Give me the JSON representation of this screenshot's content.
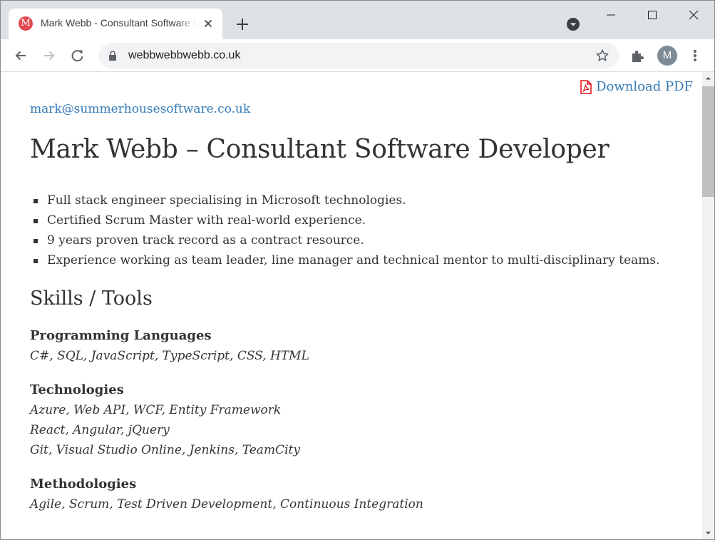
{
  "browser": {
    "tab_title": "Mark Webb - Consultant Software Developer",
    "favicon_letter": "M",
    "url": "webbwebbwebb.co.uk",
    "profile_initial": "M"
  },
  "page": {
    "download_label": "Download PDF",
    "email": "mark@summerhousesoftware.co.uk",
    "heading": "Mark Webb – Consultant Software Developer",
    "points": [
      "Full stack engineer specialising in Microsoft technologies.",
      "Certified Scrum Master with real-world experience.",
      "9 years proven track record as a contract resource.",
      "Experience working as team leader, line manager and technical mentor to multi-disciplinary teams."
    ],
    "skills_heading": "Skills / Tools",
    "skills": [
      {
        "label": "Programming Languages",
        "lines": [
          "C#, SQL, JavaScript, TypeScript, CSS, HTML"
        ]
      },
      {
        "label": "Technologies",
        "lines": [
          "Azure, Web API, WCF, Entity Framework",
          "React, Angular, jQuery",
          "Git, Visual Studio Online, Jenkins, TeamCity"
        ]
      },
      {
        "label": "Methodologies",
        "lines": [
          "Agile, Scrum, Test Driven Development, Continuous Integration"
        ]
      }
    ]
  },
  "colors": {
    "link": "#337ab7",
    "text": "#333333",
    "favicon": "#e24a4f",
    "pdf_icon": "#e8141b"
  }
}
